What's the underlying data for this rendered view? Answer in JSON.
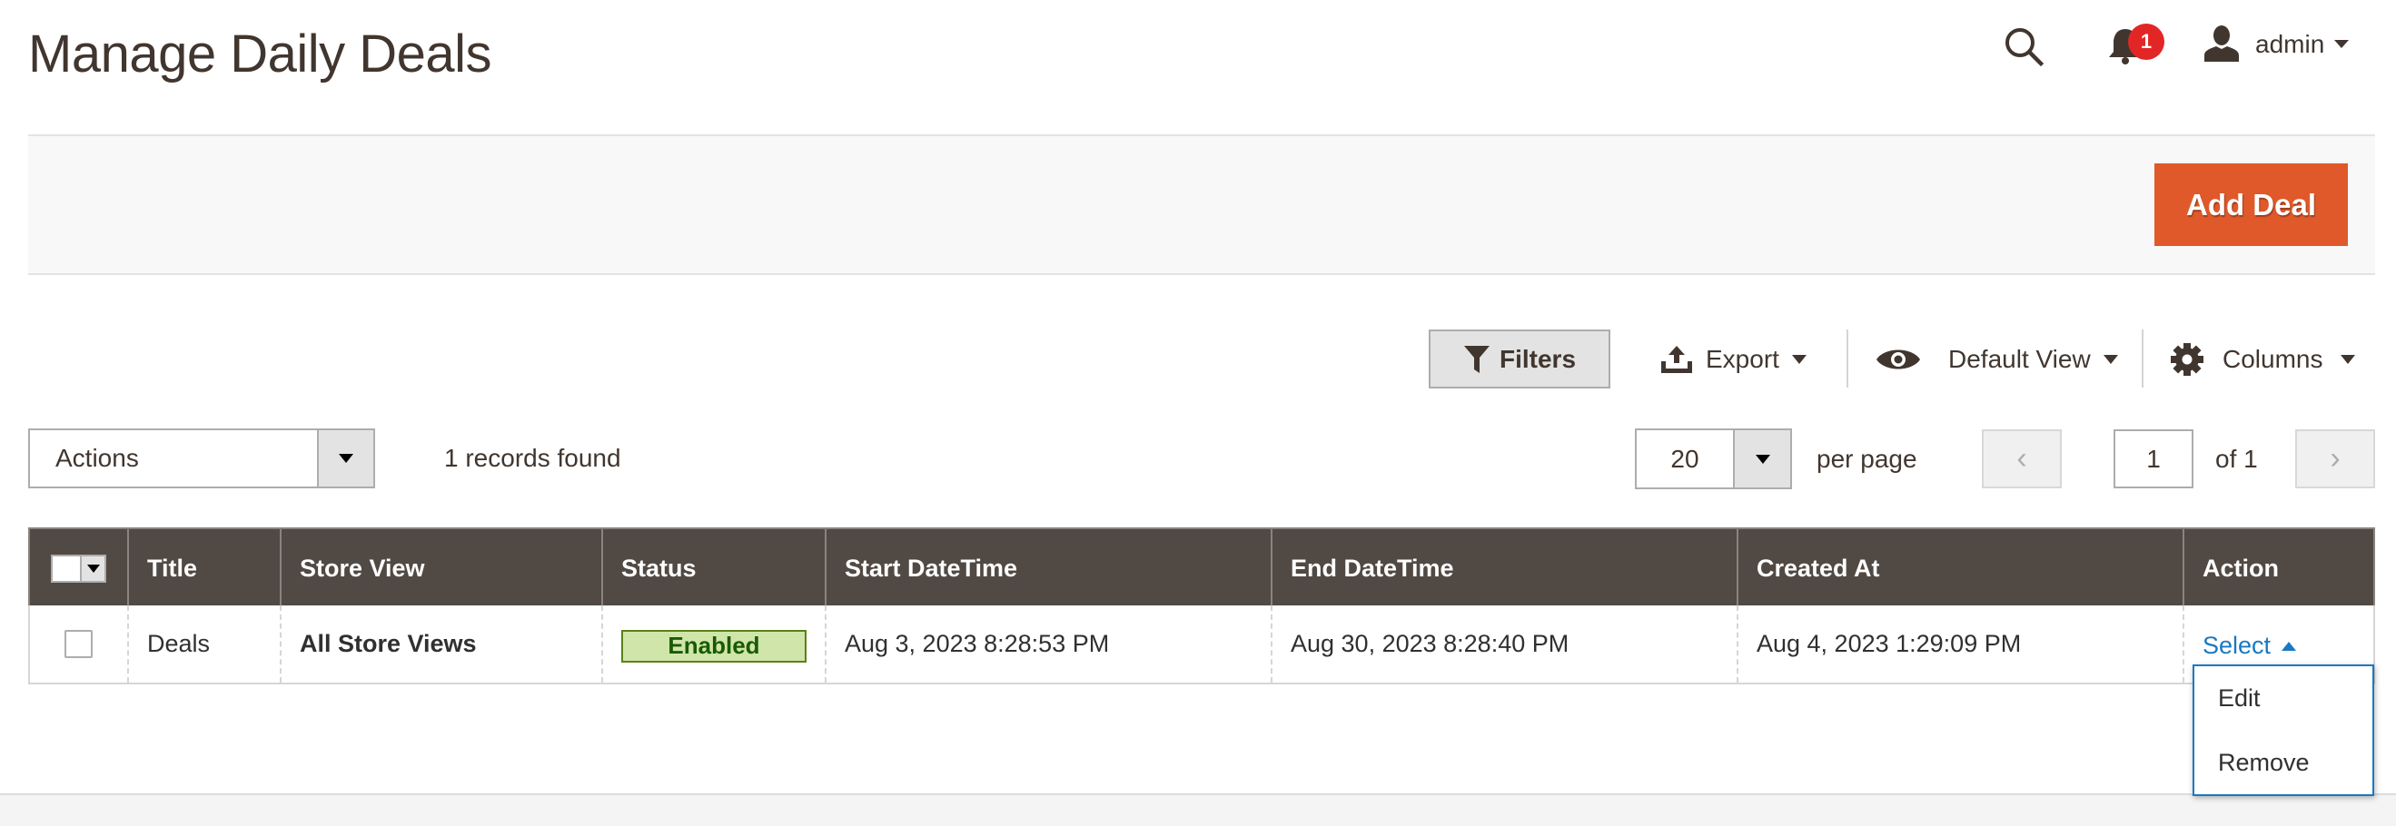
{
  "header": {
    "title": "Manage Daily Deals",
    "icons": {
      "search": "search-icon",
      "notifications": "bell-icon",
      "user": "user-icon"
    },
    "notification_count": "1",
    "user_name": "admin"
  },
  "page_actions": {
    "add_label": "Add Deal",
    "accent_color": "#e0592a"
  },
  "toolbar": {
    "filters_label": "Filters",
    "export_label": "Export",
    "view_label": "Default View",
    "columns_label": "Columns"
  },
  "mass_actions": {
    "selected": "Actions"
  },
  "records_found": "1 records found",
  "pager": {
    "per_page_value": "20",
    "per_page_label": "per page",
    "prev_symbol": "‹",
    "next_symbol": "›",
    "current_page": "1",
    "of_label": "of 1"
  },
  "grid": {
    "columns": [
      "Title",
      "Store View",
      "Status",
      "Start DateTime",
      "End DateTime",
      "Created At",
      "Action"
    ],
    "rows": [
      {
        "title": "Deals",
        "store_view": "All Store Views",
        "status": "Enabled",
        "start": "Aug 3, 2023 8:28:53 PM",
        "end": "Aug 30, 2023 8:28:40 PM",
        "created": "Aug 4, 2023 1:29:09 PM",
        "action": "Select"
      }
    ],
    "action_menu": [
      "Edit",
      "Remove"
    ]
  }
}
